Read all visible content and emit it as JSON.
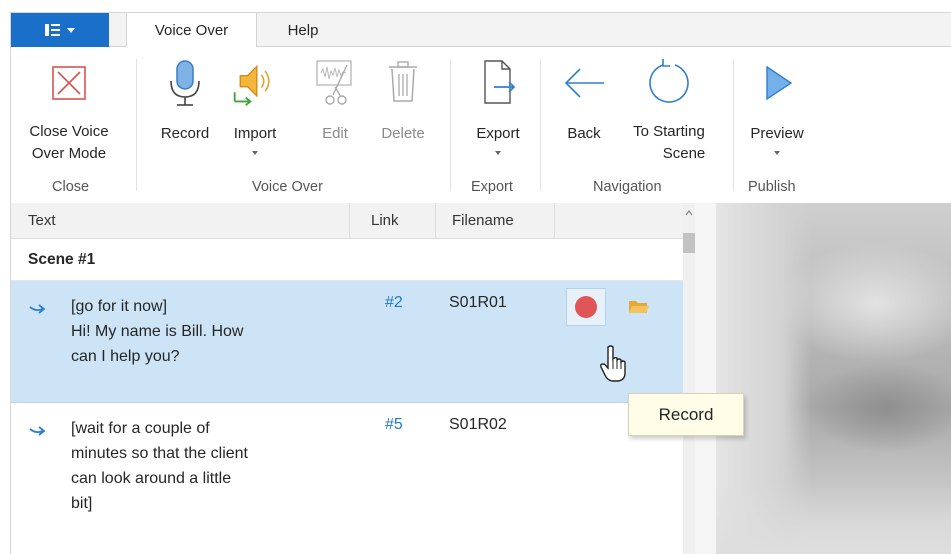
{
  "tabs": [
    {
      "label": "Voice Over",
      "active": true
    },
    {
      "label": "Help",
      "active": false
    }
  ],
  "ribbon": {
    "groups": [
      {
        "label": "Close",
        "buttons": [
          {
            "label_line1": "Close Voice",
            "label_line2": "Over Mode",
            "icon": "close-x-icon",
            "enabled": true
          }
        ]
      },
      {
        "label": "Voice Over",
        "buttons": [
          {
            "label": "Record",
            "icon": "microphone-icon",
            "enabled": true
          },
          {
            "label": "Import",
            "icon": "speaker-import-icon",
            "enabled": true,
            "dropdown": true
          },
          {
            "label": "Edit",
            "icon": "audio-cut-icon",
            "enabled": false
          },
          {
            "label": "Delete",
            "icon": "trash-icon",
            "enabled": false
          }
        ]
      },
      {
        "label": "Export",
        "buttons": [
          {
            "label": "Export",
            "icon": "export-document-icon",
            "enabled": true,
            "dropdown": true
          }
        ]
      },
      {
        "label": "Navigation",
        "buttons": [
          {
            "label": "Back",
            "icon": "arrow-left-icon",
            "enabled": true
          },
          {
            "label_line1": "To Starting",
            "label_line2": "Scene",
            "icon": "restart-icon",
            "enabled": true
          }
        ]
      },
      {
        "label": "Publish",
        "buttons": [
          {
            "label": "Preview",
            "icon": "play-icon",
            "enabled": true,
            "dropdown": true
          }
        ]
      }
    ]
  },
  "table": {
    "columns": [
      "Text",
      "Link",
      "Filename"
    ],
    "scene_header": "Scene #1",
    "rows": [
      {
        "line1": "[go for it now]",
        "line2": "Hi! My name is Bill. How",
        "line3": "can I help you?",
        "line4": "",
        "link": "#2",
        "filename": "S01R01",
        "selected": true
      },
      {
        "line1": "[wait for a couple of",
        "line2": "minutes so that the client",
        "line3": "can look around a little",
        "line4": "bit]",
        "link": "#5",
        "filename": "S01R02",
        "selected": false
      }
    ]
  },
  "tooltip": {
    "text": "Record"
  },
  "colors": {
    "accent": "#1a6fc9",
    "selection": "#cde4f7",
    "link": "#1e78d2",
    "record": "#e05555",
    "tooltip_bg": "#fffde7"
  }
}
